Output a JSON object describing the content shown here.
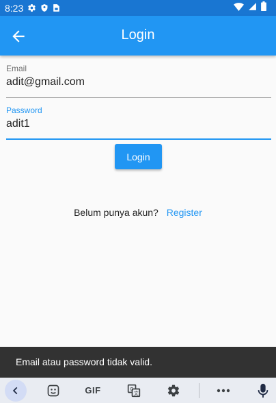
{
  "status_bar": {
    "time": "8:23",
    "icons": [
      "gear-icon",
      "shield-icon",
      "sim-card-icon",
      "wifi-icon",
      "signal-icon",
      "battery-icon"
    ]
  },
  "app_bar": {
    "title": "Login",
    "back_icon": "arrow-left-icon",
    "color": "#2196f3"
  },
  "form": {
    "email": {
      "label": "Email",
      "value": "adit@gmail.com"
    },
    "password": {
      "label": "Password",
      "value": "adit1"
    },
    "login_button": "Login"
  },
  "register": {
    "prompt": "Belum punya akun?",
    "link": "Register"
  },
  "snackbar": {
    "message": "Email atau password tidak valid."
  },
  "keyboard_toolbar": {
    "items": [
      "chevron-left-icon",
      "sticker-icon",
      "GIF",
      "translate-icon",
      "gear-icon",
      "more-icon",
      "mic-icon"
    ],
    "gif_label": "GIF"
  },
  "colors": {
    "primary": "#2196f3",
    "status_bar": "#1976d2",
    "snackbar": "#323232"
  }
}
